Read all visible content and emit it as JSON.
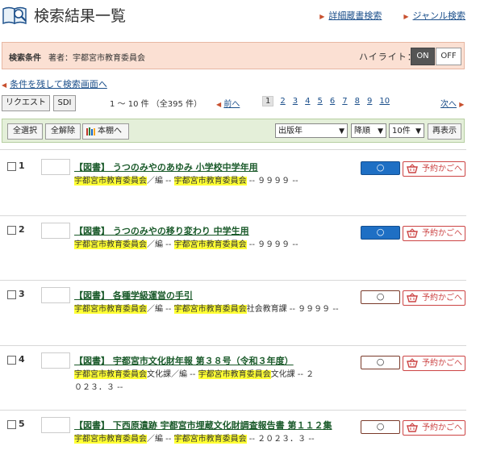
{
  "header": {
    "title": "検索結果一覧",
    "link_detail": "詳細蔵書検索",
    "link_genre": "ジャンル検索"
  },
  "conditions": {
    "label": "検索条件",
    "value": "著者：宇都宮市教育委員会",
    "highlight_label": "ハイライト：",
    "on_label": "ON",
    "off_label": "OFF"
  },
  "back_link": "条件を残して検索画面へ",
  "pager": {
    "request_label": "リクエスト",
    "sdi_label": "SDI",
    "count": "1 ～ 10 件 （全395 件）",
    "prev": "前へ",
    "next": "次へ",
    "pages": [
      "1",
      "2",
      "3",
      "4",
      "5",
      "6",
      "7",
      "8",
      "9",
      "10"
    ],
    "current_page": "1"
  },
  "toolbar": {
    "select_all": "全選択",
    "deselect_all": "全解除",
    "shelf": "本棚へ",
    "sort_field": "出版年",
    "sort_order": "降順",
    "per_page": "10件",
    "redisplay": "再表示"
  },
  "cart_label": "予約かごへ",
  "status_mark": "○",
  "results": [
    {
      "num": "1",
      "title": "【図書】 うつのみやのあゆみ 小学校中学年用",
      "author_hl1": "宇都宮市教育委員会",
      "author_mid": "／編 -- ",
      "author_hl2": "宇都宮市教育委員会",
      "author_tail": " -- ９９９９ --",
      "status": "blue"
    },
    {
      "num": "2",
      "title": "【図書】 うつのみやの移り変わり 中学生用",
      "author_hl1": "宇都宮市教育委員会",
      "author_mid": "／編 -- ",
      "author_hl2": "宇都宮市教育委員会",
      "author_tail": " -- ９９９９ --",
      "status": "blue"
    },
    {
      "num": "3",
      "title": "【図書】 各種学級運営の手引",
      "author_hl1": "宇都宮市教育委員会",
      "author_mid": "／編 -- ",
      "author_hl2": "宇都宮市教育委員会",
      "author_tail": "社会教育課 -- ９９９９ --",
      "status": "white"
    },
    {
      "num": "4",
      "title": "【図書】 宇都宮市文化財年報 第３８号（令和３年度）",
      "author_hl1": "宇都宮市教育委員会",
      "author_mid": "文化課／編 -- ",
      "author_hl2": "宇都宮市教育委員会",
      "author_tail": "文化課 -- ２０２３．３ --",
      "status": "white"
    },
    {
      "num": "5",
      "title": "【図書】 下西原遺跡 宇都宮市埋蔵文化財調査報告書 第１１２集",
      "author_hl1": "宇都宮市教育委員会",
      "author_mid": "／編 -- ",
      "author_hl2": "宇都宮市教育委員会",
      "author_tail": " -- ２０２３．３ --",
      "status": "white"
    }
  ]
}
